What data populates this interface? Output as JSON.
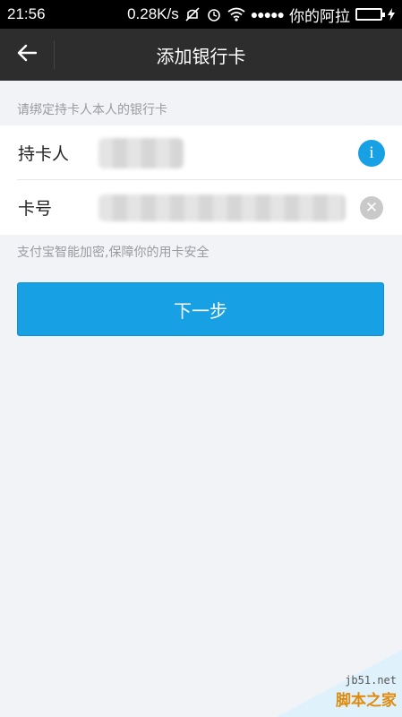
{
  "status_bar": {
    "time": "21:56",
    "speed": "0.28K/s",
    "carrier": "你的阿拉",
    "signal_dots": "●●●●●",
    "battery_color": "#3ecf2e",
    "battery_level": 0.85
  },
  "header": {
    "title": "添加银行卡",
    "back_icon": "arrow-left-icon"
  },
  "form": {
    "hint": "请绑定持卡人本人的银行卡",
    "holder_label": "持卡人",
    "holder_value": "",
    "card_label": "卡号",
    "card_value": "",
    "info_icon": "i",
    "clear_icon": "✕"
  },
  "security_note": "支付宝智能加密,保障你的用卡安全",
  "next_button": "下一步",
  "watermark": {
    "url": "jb51.net",
    "name": "脚本之家"
  },
  "colors": {
    "accent": "#18a0e4",
    "header_bg": "#2d2d2d",
    "page_bg": "#f2f3f7"
  }
}
